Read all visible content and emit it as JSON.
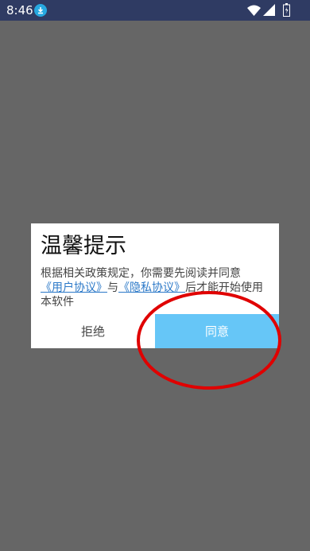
{
  "status_bar": {
    "time": "8:46"
  },
  "dialog": {
    "title": "温馨提示",
    "message_before": "根据相关政策规定，你需要先阅读并同意",
    "user_agreement_link": "《用户协议》",
    "connector": "与",
    "privacy_policy_link": "《隐私协议》",
    "message_after": "后才能开始使用本软件",
    "reject_label": "拒绝",
    "agree_label": "同意"
  },
  "colors": {
    "overlay": "#666666",
    "status_bar": "#2f3b63",
    "agree_button": "#66c6f7",
    "link": "#2c79c8",
    "highlight_circle": "#e00000"
  },
  "icons": {
    "status_left": "download-icon",
    "status_right": [
      "wifi-icon",
      "signal-icon",
      "battery-icon"
    ]
  }
}
